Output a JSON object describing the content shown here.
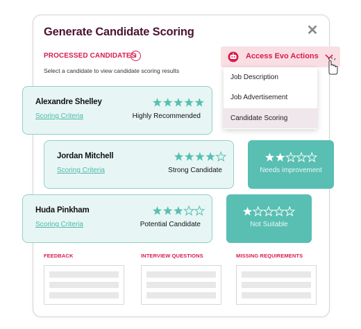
{
  "dialog": {
    "title": "Generate Candidate Scoring",
    "processed_label": "PROCESSED CANDIDATES",
    "subtitle": "Select a candidate to view candidate scoring results"
  },
  "evo": {
    "label": "Access Evo Actions",
    "menu": [
      "Job Description",
      "Job Advertisement",
      "Candidate Scoring"
    ],
    "selected": "Candidate Scoring"
  },
  "candidates": [
    {
      "name": "Alexandre Shelley",
      "link": "Scoring Criteria",
      "status": "Highly Recommended",
      "stars": 5
    },
    {
      "name": "Jordan Mitchell",
      "link": "Scoring Criteria",
      "status": "Strong Candidate",
      "stars": 4
    },
    {
      "name": "Huda Pinkham",
      "link": "Scoring Criteria",
      "status": "Potential Candidate",
      "stars": 3
    }
  ],
  "badges": [
    {
      "label": "Needs improvement",
      "stars": 2
    },
    {
      "label": "Not Suitable",
      "stars": 1
    }
  ],
  "sections": [
    "FEEDBACK",
    "INTERVIEW QUESTIONS",
    "MISSING REQUIREMENTS"
  ],
  "colors": {
    "accent": "#d81b4c",
    "title": "#4a1330",
    "teal": "#58bfb2",
    "card_bg": "#e7f6f4"
  }
}
